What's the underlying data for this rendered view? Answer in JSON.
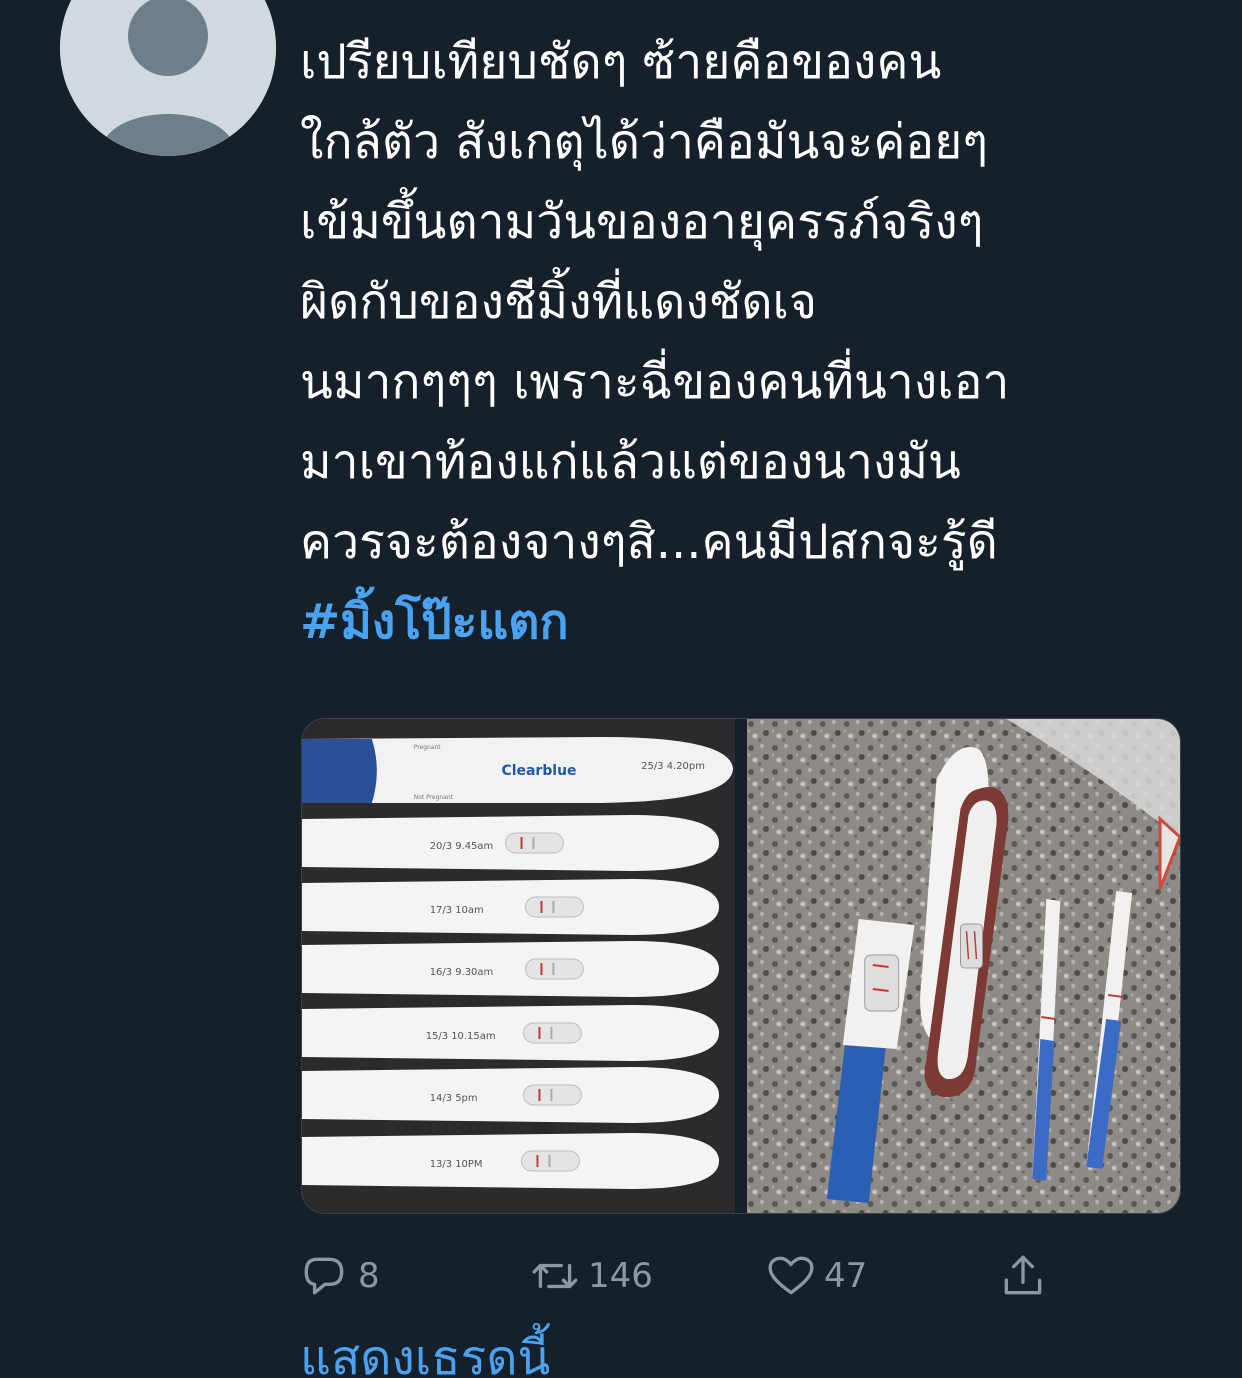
{
  "tweet": {
    "text_lines": [
      "เปรียบเทียบชัดๆ ซ้ายคือของคน",
      "ใกล้ตัว สังเกตุได้ว่าคือมันจะค่อยๆ",
      "เข้มขึ้นตามวันของอายุครรภ์จริงๆ",
      "ผิดกับของชีมิ้งที่แดงชัดเจ",
      "นมากๆๆๆ เพราะฉี่ของคนที่นางเอา",
      "มาเขาท้องแก่แล้วแต่ของนางมัน",
      "ควรจะต้องจางๆสิ...คนมีปสกจะรู้ดี"
    ],
    "hashtag": "#มิ้งโป๊ะแตก",
    "media": {
      "left_photo": {
        "brand": "Clearblue",
        "result_labels": [
          "Pregnant",
          "Not Pregnant"
        ],
        "test_labels": [
          "25/3  4.20pm",
          "20/3  9.45am",
          "17/3  10am",
          "16/3  9.30am",
          "15/3  10.15am",
          "14/3  5pm",
          "13/3  10PM"
        ]
      },
      "right_photo": {}
    }
  },
  "actions": {
    "reply_count": "8",
    "retweet_count": "146",
    "like_count": "47"
  },
  "show_thread_label": "แสดงเธรดนี้",
  "colors": {
    "background": "#15202b",
    "text": "#ffffff",
    "accent": "#4aa3f0",
    "muted": "#8899a6"
  }
}
